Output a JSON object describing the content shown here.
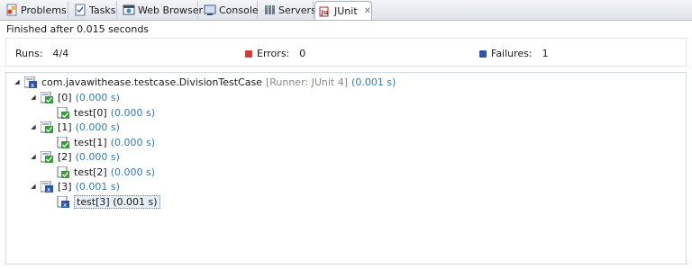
{
  "tabs": [
    {
      "label": "Problems",
      "icon": "problems-icon",
      "active": false
    },
    {
      "label": "Tasks",
      "icon": "tasks-icon",
      "active": false
    },
    {
      "label": "Web Browser",
      "icon": "web-browser-icon",
      "active": false
    },
    {
      "label": "Console",
      "icon": "console-icon",
      "active": false
    },
    {
      "label": "Servers",
      "icon": "servers-icon",
      "active": false
    },
    {
      "label": "JUnit",
      "icon": "junit-icon",
      "active": true
    }
  ],
  "status_text": "Finished after 0.015 seconds",
  "counters": {
    "runs_label": "Runs:",
    "runs_value": "4/4",
    "errors_label": "Errors:",
    "errors_value": "0",
    "failures_label": "Failures:",
    "failures_value": "1"
  },
  "tree": {
    "root": {
      "label": "com.javawithease.testcase.DivisionTestCase",
      "runner": "[Runner: JUnit 4]",
      "time": "(0.001 s)"
    },
    "groups": [
      {
        "label": "[0]",
        "time": "(0.000 s)",
        "child": {
          "label": "test[0]",
          "time": "(0.000 s)"
        }
      },
      {
        "label": "[1]",
        "time": "(0.000 s)",
        "child": {
          "label": "test[1]",
          "time": "(0.000 s)"
        }
      },
      {
        "label": "[2]",
        "time": "(0.000 s)",
        "child": {
          "label": "test[2]",
          "time": "(0.000 s)"
        }
      },
      {
        "label": "[3]",
        "time": "(0.001 s)",
        "child": {
          "label": "test[3]",
          "time": "(0.001 s)"
        }
      }
    ]
  },
  "colors": {
    "pass": "#3c9a3c",
    "fail": "#2c56a8",
    "error": "#d23c3c",
    "time": "#2e7bb8"
  }
}
